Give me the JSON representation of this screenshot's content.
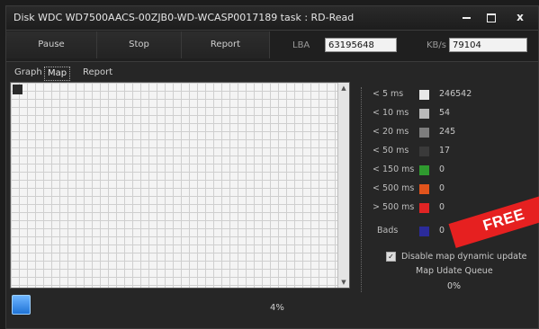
{
  "window": {
    "title": "Disk WDC WD7500AACS-00ZJB0-WD-WCASP0017189   task : RD-Read",
    "controls": {
      "minimize": "minimize-icon",
      "maximize": "maximize-icon",
      "close_label": "x"
    }
  },
  "toolbar": {
    "pause_label": "Pause",
    "stop_label": "Stop",
    "report_label": "Report",
    "lba_label": "LBA",
    "lba_value": "63195648",
    "kbs_label": "KB/s",
    "kbs_value": "79104"
  },
  "tabs": [
    {
      "label": "Graph"
    },
    {
      "label": "Map",
      "active": true
    },
    {
      "label": "Report"
    }
  ],
  "legend": [
    {
      "label": "< 5 ms",
      "color": "#e8e8e8",
      "count": "246542"
    },
    {
      "label": "< 10 ms",
      "color": "#b9b9b9",
      "count": "54"
    },
    {
      "label": "< 20 ms",
      "color": "#7d7d7d",
      "count": "245"
    },
    {
      "label": "< 50 ms",
      "color": "#3a3a3a",
      "count": "17"
    },
    {
      "label": "< 150 ms",
      "color": "#2f9a2f",
      "count": "0"
    },
    {
      "label": "< 500 ms",
      "color": "#e2541c",
      "count": "0"
    },
    {
      "label": "> 500 ms",
      "color": "#e02424",
      "count": "0"
    },
    {
      "label": "Bads",
      "color": "#2b2b9a",
      "count": "0"
    }
  ],
  "options": {
    "disable_map_label": "Disable map dynamic update",
    "disable_map_checked": true,
    "queue_label": "Map Udate Queue",
    "queue_value": "0%"
  },
  "progress": {
    "text": "4%"
  },
  "overlay": {
    "free_label": "FREE"
  }
}
